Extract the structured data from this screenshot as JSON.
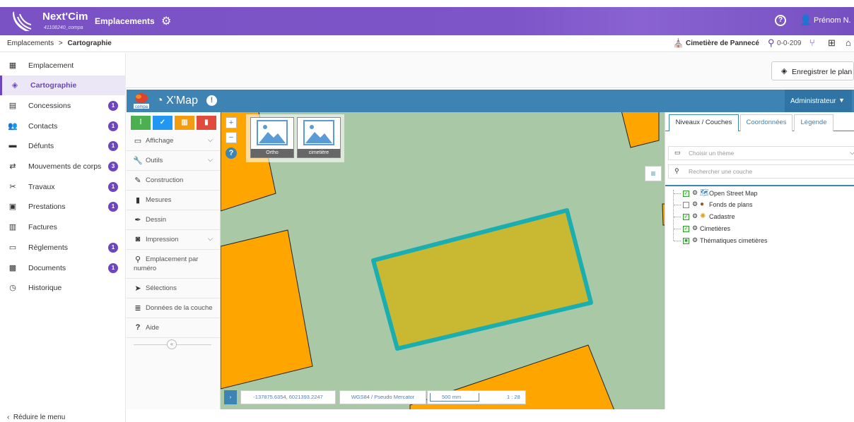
{
  "app": {
    "brand": "Next'Cim",
    "brand_sub": "41108240_compa",
    "section": "Emplacements",
    "user": "Prénom N."
  },
  "breadcrumb": {
    "parent": "Emplacements",
    "separator": ">",
    "current": "Cartographie"
  },
  "context": {
    "cemetery": "Cimetière de Pannecé",
    "location": "0-0-209"
  },
  "sidebar": {
    "items": [
      {
        "label": "Emplacement",
        "icon": "grid-list-icon",
        "badge": ""
      },
      {
        "label": "Cartographie",
        "icon": "layers-icon",
        "badge": ""
      },
      {
        "label": "Concessions",
        "icon": "document-icon",
        "badge": "1"
      },
      {
        "label": "Contacts",
        "icon": "users-icon",
        "badge": "1"
      },
      {
        "label": "Défunts",
        "icon": "id-card-icon",
        "badge": "1"
      },
      {
        "label": "Mouvements de corps",
        "icon": "arrows-icon",
        "badge": "3"
      },
      {
        "label": "Travaux",
        "icon": "tools-icon",
        "badge": "1"
      },
      {
        "label": "Prestations",
        "icon": "briefcase-icon",
        "badge": "1"
      },
      {
        "label": "Factures",
        "icon": "receipt-icon",
        "badge": ""
      },
      {
        "label": "Règlements",
        "icon": "credit-card-icon",
        "badge": "1"
      },
      {
        "label": "Documents",
        "icon": "image-icon",
        "badge": "1"
      },
      {
        "label": "Historique",
        "icon": "history-icon",
        "badge": ""
      }
    ],
    "reduce_label": "Réduire le menu"
  },
  "toolbar": {
    "save_label": "Enregistrer le plan"
  },
  "xmap": {
    "logo_text": "compa",
    "title": "X'Map",
    "role": "Administrateur"
  },
  "tools": {
    "color_tabs": [
      {
        "symbol": "⁞",
        "color": "#4caf50"
      },
      {
        "symbol": "✓",
        "color": "#2196f3"
      },
      {
        "symbol": "▥",
        "color": "#f39c12"
      },
      {
        "symbol": "▮",
        "color": "#e04b3c"
      }
    ],
    "items": [
      {
        "label": "Affichage",
        "icon": "monitor-icon",
        "expand": true
      },
      {
        "label": "Outils",
        "icon": "wrench-icon",
        "expand": true
      },
      {
        "label": "Construction",
        "icon": "pencil-icon",
        "expand": false
      },
      {
        "label": "Mesures",
        "icon": "bookmark-icon",
        "expand": false
      },
      {
        "label": "Dessin",
        "icon": "brush-icon",
        "expand": false
      },
      {
        "label": "Impression",
        "icon": "camera-icon",
        "expand": true
      },
      {
        "label": "Emplacement par numéro",
        "icon": "search-icon",
        "expand": false
      },
      {
        "label": "Sélections",
        "icon": "cursor-icon",
        "expand": false
      },
      {
        "label": "Données de la couche",
        "icon": "database-icon",
        "expand": false
      },
      {
        "label": "Aide",
        "icon": "question-icon",
        "expand": false
      }
    ]
  },
  "map": {
    "basemaps": [
      "Ortho",
      "cimetière"
    ],
    "coordinates": "-137875.6354, 6021393.2247",
    "projection": "WGS84 / Pseudo Mercator",
    "scale_bar": "500 mm",
    "scale": "1 : 28"
  },
  "layers_panel": {
    "tabs": [
      "Niveaux / Couches",
      "Coordonnées",
      "Légende"
    ],
    "theme_placeholder": "Choisir un thème",
    "search_placeholder": "Rechercher une couche",
    "layers": [
      {
        "name": "Open Street Map",
        "checked": true,
        "icon": "map-icon"
      },
      {
        "name": "Fonds de plans",
        "checked": false,
        "icon": "globe-icon"
      },
      {
        "name": "Cadastre",
        "checked": true,
        "icon": "cadastre-icon"
      },
      {
        "name": "Cimetières",
        "checked": true,
        "icon": ""
      },
      {
        "name": "Thématiques cimetières",
        "checked": true,
        "icon": ""
      }
    ]
  },
  "colors": {
    "brand_purple": "#7a52c4",
    "xmap_blue": "#3d84b5",
    "plot_orange": "#ffa500",
    "selected_plot": "#c8b832",
    "selection_outline": "#1aaeb0",
    "map_ground": "#a9c9a6"
  }
}
